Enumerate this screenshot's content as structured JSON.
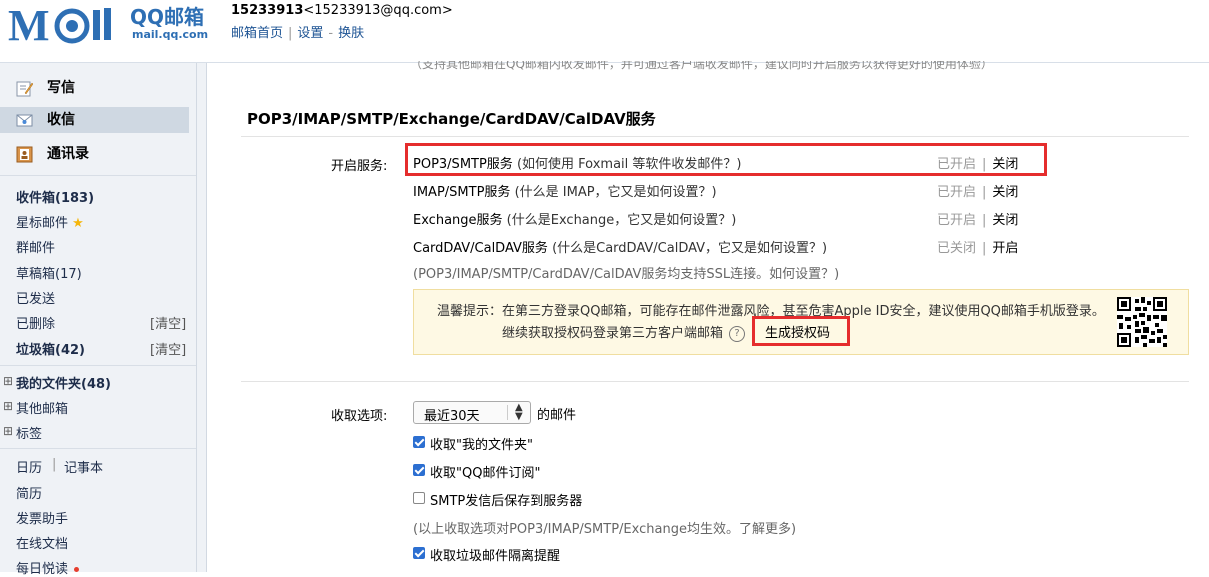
{
  "header": {
    "logo_text": "M il",
    "logo_qq": "QQ邮箱",
    "logo_url": "mail.qq.com",
    "account_number": "15233913",
    "account_email": "<15233913@qq.com>",
    "links": [
      "邮箱首页",
      "设置",
      "换肤"
    ],
    "link_separators": [
      "|",
      "-"
    ]
  },
  "sidebar": {
    "compose": "写信",
    "inbox": "收信",
    "contacts": "通讯录",
    "folders": [
      {
        "label": "收件箱(183)"
      },
      {
        "label": "星标邮件"
      },
      {
        "label": "群邮件"
      },
      {
        "label": "草稿箱(17)"
      },
      {
        "label": "已发送"
      },
      {
        "label": "已删除",
        "action": "[清空]"
      },
      {
        "label": "垃圾箱(42)",
        "action": "[清空]"
      }
    ],
    "groups": [
      "我的文件夹(48)",
      "其他邮箱",
      "标签"
    ],
    "tools_row": [
      "日历",
      "|",
      "记事本"
    ],
    "tools": [
      "简历",
      "发票助手",
      "在线文档",
      "每日悦读"
    ]
  },
  "main": {
    "cut_line": "（支持其他邮箱在QQ邮箱内收发邮件，并可通过客户端收发邮件，建议同时开启服务以获得更好的使用体验）",
    "section_title": "POP3/IMAP/SMTP/Exchange/CardDAV/CalDAV服务",
    "services_label": "开启服务:",
    "services": [
      {
        "name": "POP3/SMTP服务",
        "help": "(如何使用 Foxmail 等软件收发邮件？)",
        "state": "已开启",
        "action": "关闭"
      },
      {
        "name": "IMAP/SMTP服务",
        "help": "(什么是 IMAP，它又是如何设置？)",
        "state": "已开启",
        "action": "关闭"
      },
      {
        "name": "Exchange服务",
        "help": "(什么是Exchange，它又是如何设置？)",
        "state": "已开启",
        "action": "关闭"
      },
      {
        "name": "CardDAV/CalDAV服务",
        "help": "(什么是CardDAV/CalDAV，它又是如何设置？)",
        "state": "已关闭",
        "action": "开启"
      }
    ],
    "ssl_note": "(POP3/IMAP/SMTP/CardDAV/CalDAV服务均支持SSL连接。如何设置？)",
    "warning_line1": "温馨提示：在第三方登录QQ邮箱，可能存在邮件泄露风险，甚至危害Apple ID安全，建议使用QQ邮箱手机版登录。",
    "warning_line2": "继续获取授权码登录第三方客户端邮箱",
    "help_icon": "?",
    "generate_code": "生成授权码",
    "receive_label": "收取选项:",
    "receive_select": "最近30天",
    "receive_suffix": "的邮件",
    "options": [
      {
        "label": "收取\"我的文件夹\"",
        "checked": true
      },
      {
        "label": "收取\"QQ邮件订阅\"",
        "checked": true
      },
      {
        "label": "SMTP发信后保存到服务器",
        "checked": false
      }
    ],
    "options_note": "(以上收取选项对POP3/IMAP/SMTP/Exchange均生效。了解更多)",
    "spam_option": {
      "label": "收取垃圾邮件隔离提醒",
      "checked": true
    }
  },
  "colors": {
    "brand": "#2e6fb4",
    "highlight_red": "#e52d2d",
    "warning_bg": "#fef9e4",
    "checkbox": "#2c6fd1"
  }
}
